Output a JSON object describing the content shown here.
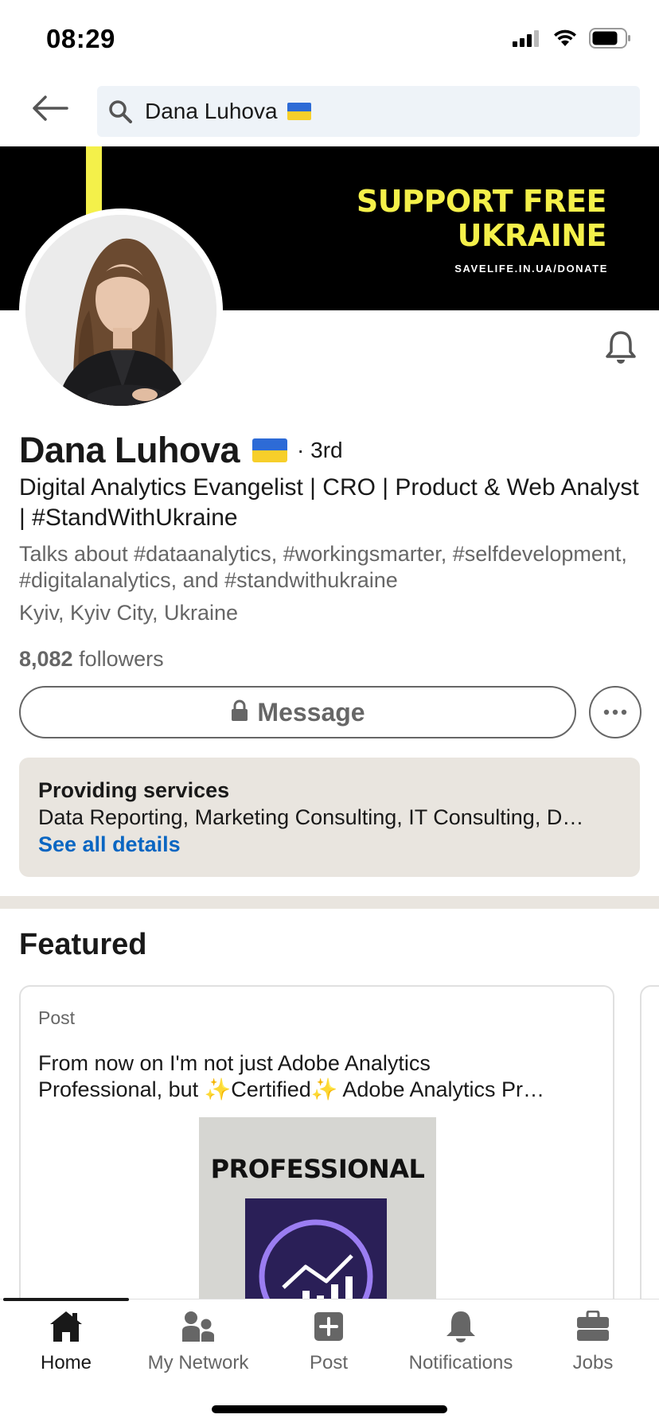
{
  "status_bar": {
    "time": "08:29",
    "icons": [
      "signal-icon",
      "wifi-icon",
      "battery-icon"
    ]
  },
  "search": {
    "query": "Dana Luhova",
    "icons": [
      "back-arrow-icon",
      "search-icon",
      "ukraine-flag-icon"
    ]
  },
  "banner": {
    "title_line1": "SUPPORT FREE",
    "title_line2": "UKRAINE",
    "subtitle": "SAVELIFE.IN.UA/DONATE",
    "colors": {
      "background": "#000000",
      "accent": "#f4f04a"
    }
  },
  "profile": {
    "name": "Dana Luhova",
    "degree": "· 3rd",
    "headline": "Digital Analytics Evangelist | CRO | Product & Web Analyst | #StandWithUkraine",
    "talks_about": "Talks about #dataanalytics, #workingsmarter, #selfdevelopment, #digitalanalytics, and #standwithukraine",
    "location": "Kyiv, Kyiv City, Ukraine",
    "followers_count": "8,082",
    "followers_label": "followers"
  },
  "actions": {
    "message_label": "Message",
    "icons": [
      "lock-icon",
      "more-icon",
      "bell-icon"
    ]
  },
  "services": {
    "title": "Providing services",
    "list": "Data Reporting, Marketing Consulting, IT Consulting, D…",
    "link": "See all details"
  },
  "featured": {
    "title": "Featured",
    "cards": [
      {
        "type": "Post",
        "text_line1": "From now on I'm not just Adobe Analytics",
        "text_line2": "Professional, but ✨Certified✨ Adobe Analytics Pr…",
        "image_label": "PROFESSIONAL"
      }
    ]
  },
  "nav": {
    "items": [
      {
        "label": "Home",
        "icon": "home-icon",
        "active": true
      },
      {
        "label": "My Network",
        "icon": "network-icon",
        "active": false
      },
      {
        "label": "Post",
        "icon": "post-icon",
        "active": false
      },
      {
        "label": "Notifications",
        "icon": "notifications-icon",
        "active": false
      },
      {
        "label": "Jobs",
        "icon": "jobs-icon",
        "active": false
      }
    ]
  },
  "colors": {
    "link": "#0a66c2",
    "search_bg": "#eef3f8",
    "card_bg": "#e9e5df",
    "secondary_text": "#666666"
  }
}
